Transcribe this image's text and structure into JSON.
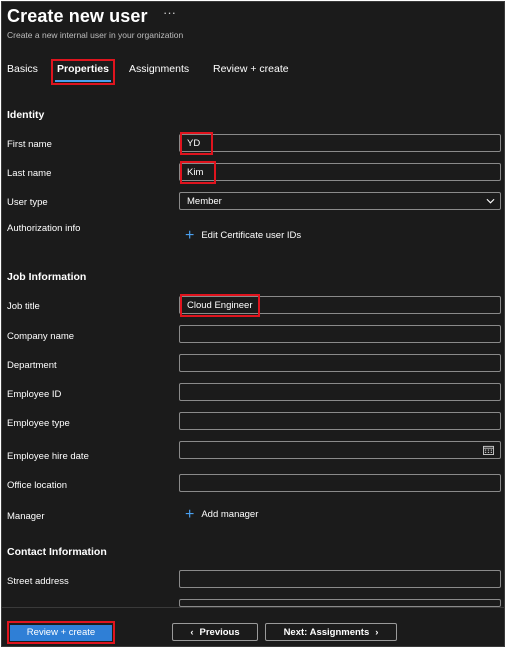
{
  "header": {
    "title": "Create new user",
    "more_label": "···",
    "subtitle": "Create a new internal user in your organization"
  },
  "tabs": [
    {
      "label": "Basics",
      "active": false
    },
    {
      "label": "Properties",
      "active": true
    },
    {
      "label": "Assignments",
      "active": false
    },
    {
      "label": "Review + create",
      "active": false
    }
  ],
  "identity": {
    "heading": "Identity",
    "first_name": {
      "label": "First name",
      "value": "YD"
    },
    "last_name": {
      "label": "Last name",
      "value": "Kim"
    },
    "user_type": {
      "label": "User type",
      "value": "Member"
    },
    "authorization": {
      "label": "Authorization info",
      "action": "Edit Certificate user IDs"
    }
  },
  "job": {
    "heading": "Job Information",
    "job_title": {
      "label": "Job title",
      "value": "Cloud Engineer"
    },
    "company_name": {
      "label": "Company name",
      "value": ""
    },
    "department": {
      "label": "Department",
      "value": ""
    },
    "employee_id": {
      "label": "Employee ID",
      "value": ""
    },
    "employee_type": {
      "label": "Employee type",
      "value": ""
    },
    "hire_date": {
      "label": "Employee hire date",
      "value": ""
    },
    "office_location": {
      "label": "Office location",
      "value": ""
    },
    "manager": {
      "label": "Manager",
      "action": "Add manager"
    }
  },
  "contact": {
    "heading": "Contact Information",
    "street_address": {
      "label": "Street address",
      "value": ""
    }
  },
  "footer": {
    "review_create": "Review + create",
    "previous": "Previous",
    "next": "Next: Assignments"
  },
  "colors": {
    "background": "#1b1b1b",
    "accent": "#4aa0f0",
    "primary_button": "#2f7fd6",
    "highlight": "#e0141e"
  }
}
